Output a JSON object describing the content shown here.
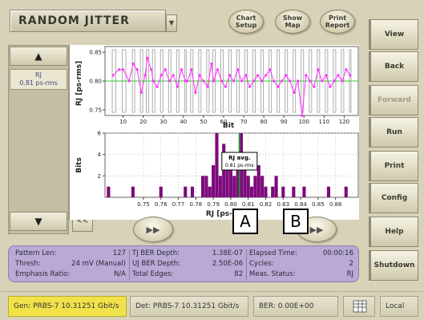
{
  "header": {
    "title": "RANDOM JITTER",
    "buttons": [
      {
        "label": "Chart Setup"
      },
      {
        "label": "Show Map"
      },
      {
        "label": "Print Report"
      }
    ]
  },
  "nav_panel": {
    "up_symbol": "▲",
    "down_symbol": "▼",
    "item": {
      "name": "RJ",
      "value": "0.81 ps-rms"
    },
    "collapse_label": "<<"
  },
  "play_symbol": "▶▶",
  "annotation_labels": [
    "A",
    "B"
  ],
  "side_buttons": [
    {
      "label": "View",
      "enabled": true
    },
    {
      "label": "Back",
      "enabled": true
    },
    {
      "label": "Forward",
      "enabled": false
    },
    {
      "label": "Run",
      "enabled": true
    },
    {
      "label": "Print",
      "enabled": true
    },
    {
      "label": "Config",
      "enabled": true
    },
    {
      "label": "Help",
      "enabled": true
    },
    {
      "label": "Shutdown",
      "enabled": true
    }
  ],
  "stats": {
    "col1": [
      {
        "label": "Pattern Len:",
        "value": "127"
      },
      {
        "label": "Thresh:",
        "value": "24 mV  (Manual)"
      },
      {
        "label": "Emphasis Ratio:",
        "value": "N/A"
      }
    ],
    "col2": [
      {
        "label": "TJ BER Depth:",
        "value": "1.38E-07"
      },
      {
        "label": "UJ BER Depth:",
        "value": "2.50E-06"
      },
      {
        "label": "Total Edges:",
        "value": "82"
      }
    ],
    "col3": [
      {
        "label": "Elapsed Time:",
        "value": "00:00:16"
      },
      {
        "label": "Cycles:",
        "value": "2"
      },
      {
        "label": "Meas. Status:",
        "value": "RJ"
      }
    ]
  },
  "status_bar": {
    "generator": "Gen: PRBS-7 10.31251 Gbit/s",
    "detector": "Det: PRBS-7 10.31251 Gbit/s",
    "ber": "BER: 0.00E+00",
    "mode": "Local"
  },
  "colors": {
    "series": "#ff33ff",
    "reference_line": "#33cc33",
    "histogram_bar": "#7d0a7d",
    "average_line": "#2e8b2e",
    "stats_panel": "#b9a9d4",
    "gen_highlight": "#f1e24a"
  },
  "chart_data": [
    {
      "type": "line",
      "xlabel": "Bit",
      "ylabel": "RJ [ps-rms]",
      "xlim": [
        1,
        127
      ],
      "ylim": [
        0.74,
        0.86
      ],
      "xticks": [
        10,
        20,
        30,
        40,
        50,
        60,
        70,
        80,
        90,
        100,
        110,
        120
      ],
      "yticks": [
        "0.75",
        "0.80",
        "0.85"
      ],
      "reference_value": 0.8,
      "grid": true,
      "x": [
        5,
        8,
        10,
        13,
        15,
        17,
        19,
        21,
        22,
        24,
        25,
        27,
        29,
        31,
        33,
        35,
        37,
        39,
        41,
        42,
        44,
        46,
        48,
        50,
        52,
        54,
        55,
        57,
        59,
        61,
        63,
        65,
        67,
        69,
        71,
        73,
        75,
        77,
        79,
        81,
        83,
        85,
        87,
        89,
        91,
        93,
        95,
        97,
        99,
        101,
        103,
        105,
        107,
        109,
        111,
        113,
        115,
        117,
        119,
        121,
        123
      ],
      "y": [
        0.81,
        0.82,
        0.82,
        0.8,
        0.83,
        0.82,
        0.78,
        0.81,
        0.84,
        0.82,
        0.8,
        0.79,
        0.81,
        0.82,
        0.8,
        0.81,
        0.79,
        0.82,
        0.8,
        0.8,
        0.82,
        0.78,
        0.81,
        0.8,
        0.79,
        0.83,
        0.8,
        0.82,
        0.8,
        0.79,
        0.81,
        0.8,
        0.82,
        0.8,
        0.81,
        0.79,
        0.8,
        0.81,
        0.8,
        0.81,
        0.82,
        0.8,
        0.79,
        0.8,
        0.81,
        0.8,
        0.78,
        0.8,
        0.74,
        0.81,
        0.8,
        0.79,
        0.82,
        0.8,
        0.81,
        0.79,
        0.8,
        0.81,
        0.8,
        0.82,
        0.81
      ]
    },
    {
      "type": "bar",
      "xlabel": "RJ [ps-rms]",
      "ylabel": "Bits",
      "xlim": [
        0.728,
        0.873
      ],
      "ylim": [
        0,
        6
      ],
      "xticks": [
        "0.75",
        "0.76",
        "0.77",
        "0.78",
        "0.79",
        "0.80",
        "0.81",
        "0.82",
        "0.83",
        "0.84",
        "0.85",
        "0.86"
      ],
      "yticks": [
        "2",
        "4",
        "6"
      ],
      "grid": true,
      "annotation": {
        "label": "RJ avg.",
        "value": "0.81 ps-rms",
        "x": 0.805
      },
      "x": [
        0.73,
        0.744,
        0.76,
        0.774,
        0.778,
        0.784,
        0.786,
        0.788,
        0.79,
        0.792,
        0.794,
        0.796,
        0.798,
        0.8,
        0.802,
        0.804,
        0.806,
        0.808,
        0.81,
        0.812,
        0.814,
        0.816,
        0.818,
        0.82,
        0.824,
        0.826,
        0.83,
        0.836,
        0.842,
        0.856,
        0.866
      ],
      "values": [
        1,
        1,
        1,
        1,
        1,
        2,
        2,
        1,
        3,
        6,
        2,
        5,
        3,
        4,
        2,
        4,
        6,
        3,
        2,
        1,
        2,
        3,
        2,
        1,
        1,
        2,
        1,
        1,
        1,
        1,
        1
      ]
    }
  ]
}
